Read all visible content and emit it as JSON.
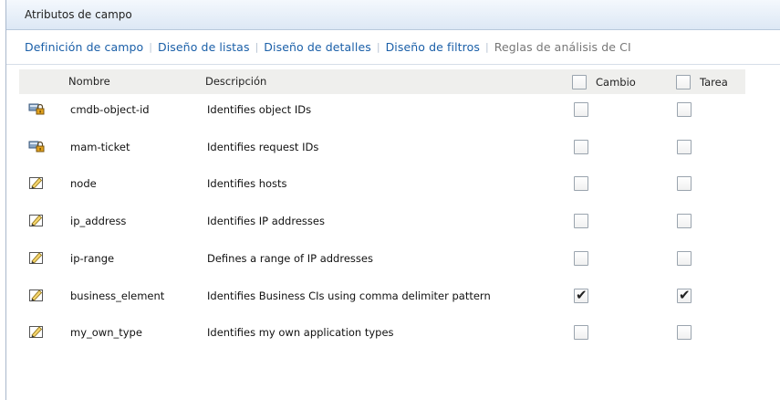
{
  "panel": {
    "title": "Atributos de campo"
  },
  "tabs": [
    {
      "label": "Definición de campo",
      "enabled": true
    },
    {
      "label": "Diseño de listas",
      "enabled": true
    },
    {
      "label": "Diseño de detalles",
      "enabled": true
    },
    {
      "label": "Diseño de filtros",
      "enabled": true
    },
    {
      "label": "Reglas de análisis de CI",
      "enabled": false
    }
  ],
  "grid": {
    "columns": {
      "name": "Nombre",
      "description": "Descripción",
      "change": "Cambio",
      "task": "Tarea"
    },
    "header_checks": {
      "change": false,
      "task": false
    },
    "rows": [
      {
        "icon": "lock-field-icon",
        "name": "cmdb-object-id",
        "description": "Identifies object IDs",
        "change": false,
        "task": false
      },
      {
        "icon": "lock-field-icon",
        "name": "mam-ticket",
        "description": "Identifies request IDs",
        "change": false,
        "task": false
      },
      {
        "icon": "edit-pencil-icon",
        "name": "node",
        "description": "Identifies hosts",
        "change": false,
        "task": false
      },
      {
        "icon": "edit-pencil-icon",
        "name": "ip_address",
        "description": "Identifies IP addresses",
        "change": false,
        "task": false
      },
      {
        "icon": "edit-pencil-icon",
        "name": "ip-range",
        "description": "Defines a range of IP addresses",
        "change": false,
        "task": false
      },
      {
        "icon": "edit-pencil-icon",
        "name": "business_element",
        "description": "Identifies Business CIs using comma delimiter pattern",
        "change": true,
        "task": true
      },
      {
        "icon": "edit-pencil-icon",
        "name": "my_own_type",
        "description": "Identifies my own application types",
        "change": false,
        "task": false
      }
    ]
  }
}
